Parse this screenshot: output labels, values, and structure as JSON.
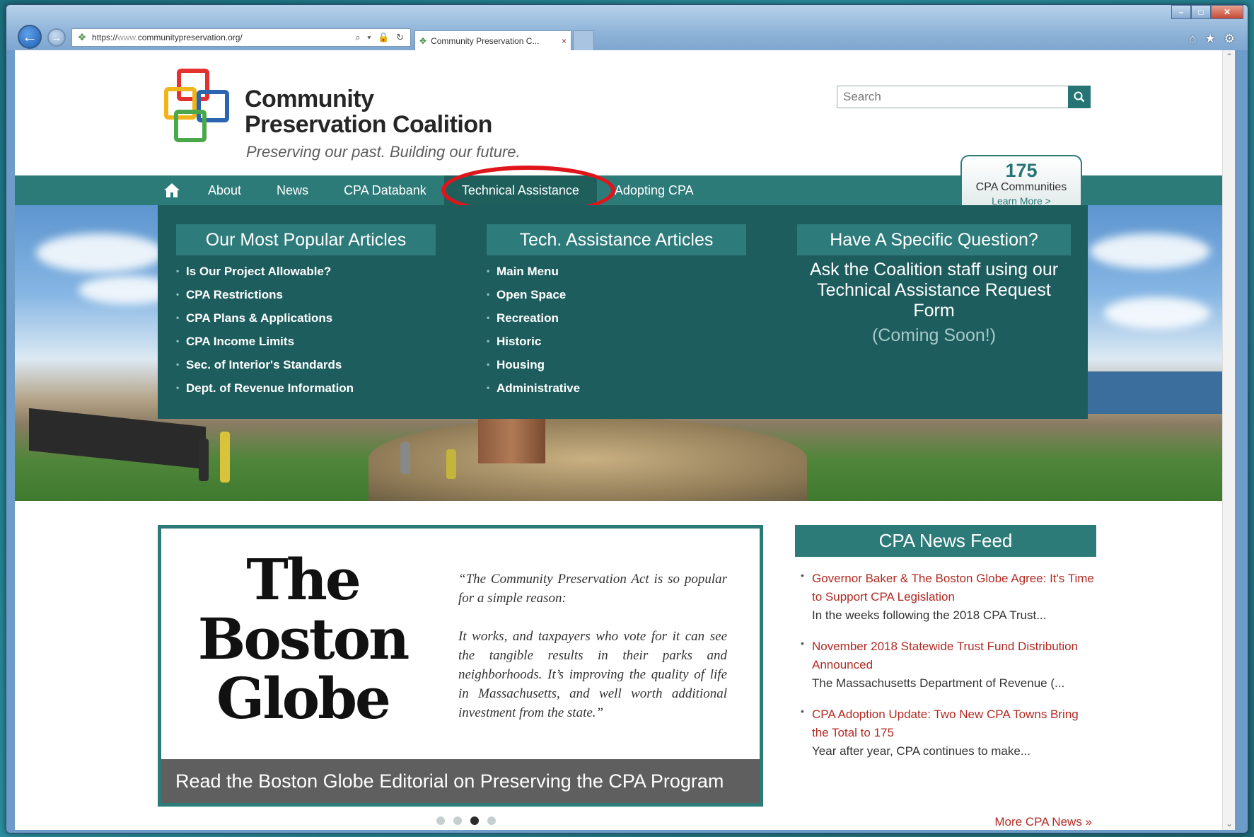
{
  "browser": {
    "url_prefix": "https://",
    "url_sub": "www.",
    "url_domain": "communitypreservation.org/",
    "address_tools": "⌕ ▾ 🔒 ↻",
    "tab_title": "Community Preservation C...",
    "tab_close": "×",
    "window_controls": {
      "min": "–",
      "max": "□",
      "close": "✕"
    },
    "icons": {
      "home": "⌂",
      "favorites": "★",
      "settings": "⚙"
    }
  },
  "header": {
    "logo_line1": "Community",
    "logo_line2": "Preservation Coalition",
    "tagline": "Preserving our past. Building our future.",
    "search_placeholder": "Search"
  },
  "nav": {
    "items": [
      "About",
      "News",
      "CPA Databank",
      "Technical Assistance",
      "Adopting CPA"
    ],
    "active": "Technical Assistance"
  },
  "badge": {
    "count": "175",
    "label": "CPA Communities",
    "more": "Learn More >"
  },
  "mega_menu": {
    "popular": {
      "heading": "Our Most Popular Articles",
      "items": [
        "Is Our Project Allowable?",
        "CPA Restrictions",
        "CPA Plans & Applications",
        "CPA Income Limits",
        "Sec. of Interior's Standards",
        "Dept. of Revenue Information"
      ]
    },
    "tech": {
      "heading": "Tech. Assistance Articles",
      "items": [
        "Main Menu",
        "Open Space",
        "Recreation",
        "Historic",
        "Housing",
        "Administrative"
      ]
    },
    "question": {
      "heading": "Have A Specific Question?",
      "text": "Ask the Coalition staff using our Technical Assistance Request Form",
      "status": "(Coming Soon!)"
    }
  },
  "slider": {
    "masthead": [
      "The",
      "Boston",
      "Globe"
    ],
    "quote_p1": "“The Community Preservation Act is so popular for a simple reason:",
    "quote_p2": "It works, and taxpayers who vote for it can see the tangible results in their parks and neighborhoods. It’s improving the quality of life in Massachusetts, and well worth additional investment from the state.”",
    "caption": "Read the Boston Globe Editorial on Preserving the CPA Program",
    "slide_count": 4,
    "active_slide": 3
  },
  "news_feed": {
    "heading": "CPA News Feed",
    "items": [
      {
        "title": "Governor Baker & The Boston Globe Agree: It's Time to Support CPA Legislation",
        "excerpt": "In the weeks following the 2018 CPA Trust..."
      },
      {
        "title": "November 2018 Statewide Trust Fund Distribution Announced",
        "excerpt": "The Massachusetts Department of Revenue (..."
      },
      {
        "title": "CPA Adoption Update: Two New CPA Towns Bring the Total to 175",
        "excerpt": "Year after year, CPA continues to make..."
      }
    ],
    "more": "More CPA News »"
  },
  "colors": {
    "brand_teal": "#2c7b79",
    "menu_dark": "#1e5d5e",
    "link_red": "#b22a22",
    "highlight": "#e0141b"
  }
}
